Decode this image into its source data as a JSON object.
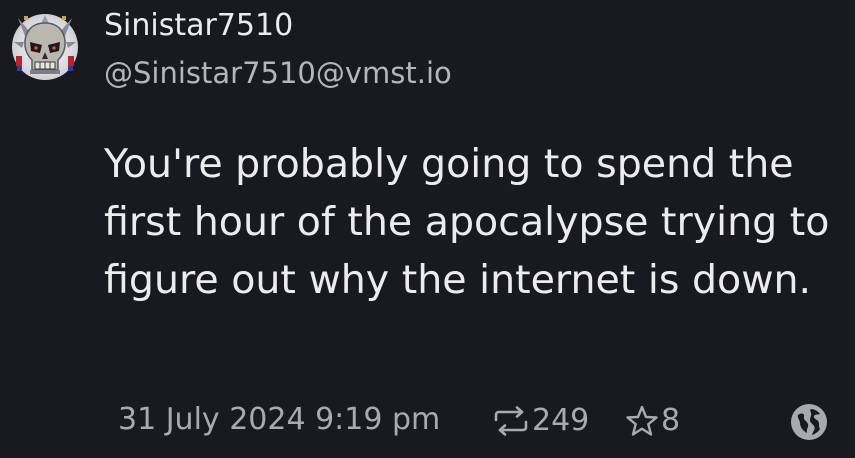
{
  "post": {
    "author": {
      "display_name": "Sinistar7510",
      "handle": "@Sinistar7510@vmst.io",
      "avatar_icon": "skull-avatar-icon"
    },
    "content": "You're probably going to spend the first hour of the apocalypse trying to figure out why the internet is down.",
    "timestamp": "31 July 2024 9:19 pm",
    "reblog_count": "249",
    "favourite_count": "8",
    "visibility_icon": "globe-icon"
  },
  "colors": {
    "background": "#191a1f",
    "text_primary": "#ececee",
    "text_secondary": "#b5b6ba",
    "text_muted": "#a9aaaf",
    "icon": "#a9aaaf"
  }
}
